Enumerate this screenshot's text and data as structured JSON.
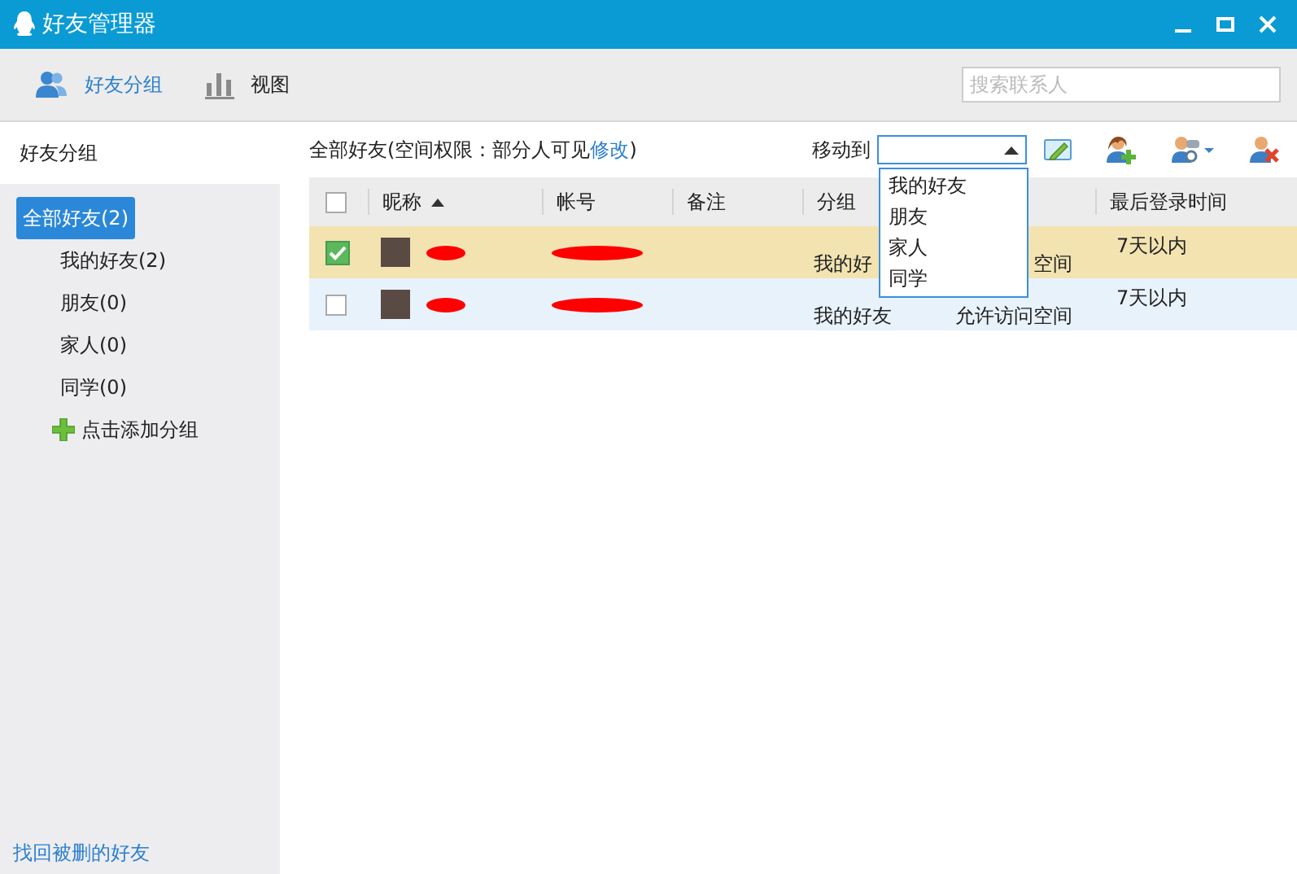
{
  "window": {
    "title": "好友管理器"
  },
  "toolbar": {
    "tabs": [
      {
        "label": "好友分组",
        "selected": true
      },
      {
        "label": "视图",
        "selected": false
      }
    ],
    "search": {
      "placeholder": "搜索联系人"
    }
  },
  "sidebar": {
    "title": "好友分组",
    "groups": [
      {
        "label": "全部好友(2)",
        "selected": true
      },
      {
        "label": "我的好友(2)",
        "selected": false
      },
      {
        "label": "朋友(0)",
        "selected": false
      },
      {
        "label": "家人(0)",
        "selected": false
      },
      {
        "label": "同学(0)",
        "selected": false
      }
    ],
    "add_group": "点击添加分组",
    "recover_link": "找回被删的好友"
  },
  "main": {
    "summary": "全部好友(空间权限：部分人可见",
    "edit_link": "修改",
    "summary_end": ")",
    "move_to": {
      "label": "移动到",
      "expanded": true,
      "options": [
        "我的好友",
        "朋友",
        "家人",
        "同学"
      ]
    },
    "table": {
      "header_checked": false,
      "columns": [
        "昵称",
        "帐号",
        "备注",
        "分组",
        "最后登录时间"
      ],
      "rows": [
        {
          "checked": true,
          "selected": true,
          "group": "我的好",
          "column_6": "空间",
          "last_login": "7天以内"
        },
        {
          "checked": false,
          "selected": false,
          "group": "我的好友",
          "column_6": "允许访问空间",
          "last_login": "7天以内"
        }
      ]
    }
  }
}
